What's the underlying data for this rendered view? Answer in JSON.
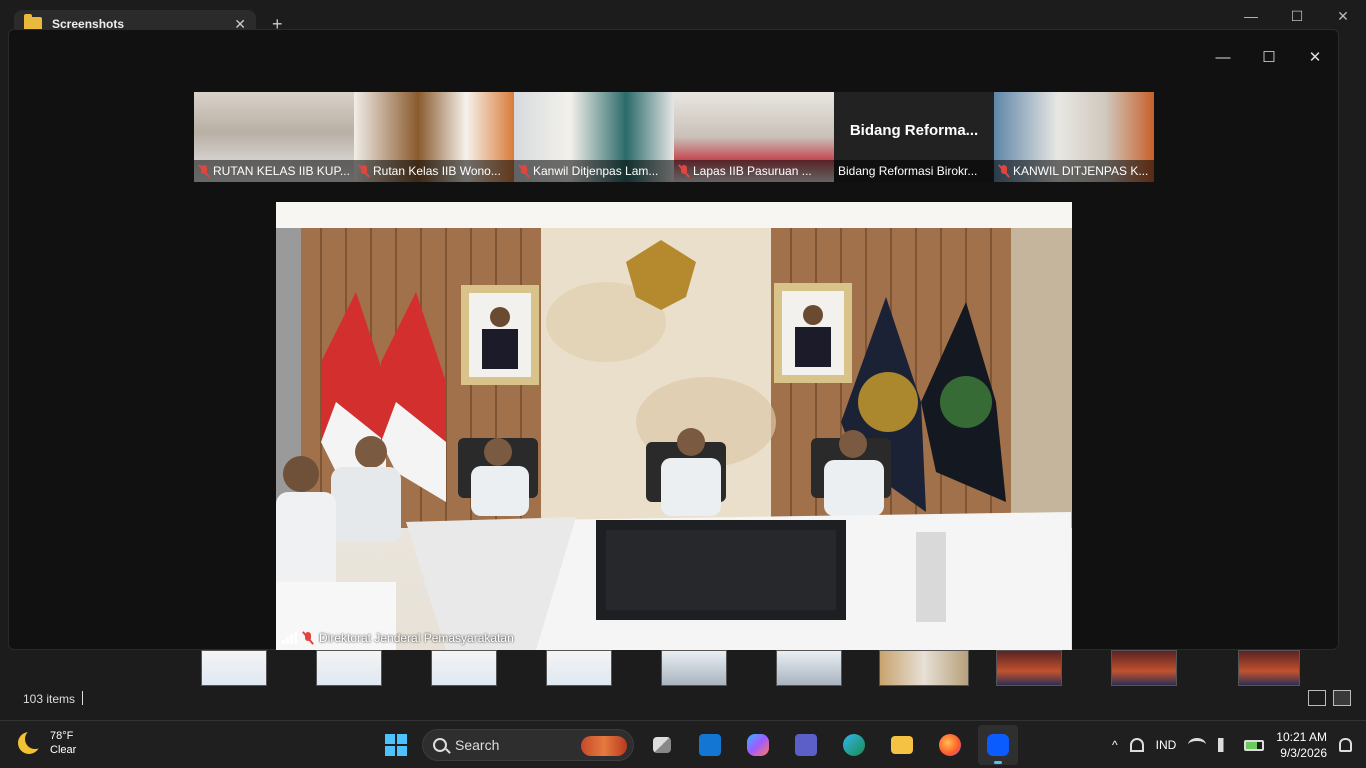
{
  "explorer": {
    "tab_title": "Screenshots",
    "tab_close": "✕",
    "new_tab": "+",
    "minimize": "—",
    "maximize": "☐",
    "close": "✕",
    "item_count": "103 items"
  },
  "zoom": {
    "minimize": "—",
    "maximize": "☐",
    "close": "✕",
    "gallery": [
      {
        "name": "RUTAN KELAS IIB KUP..."
      },
      {
        "name": "Rutan Kelas IIB Wono..."
      },
      {
        "name": "Kanwil Ditjenpas Lam..."
      },
      {
        "name": "Lapas IIB Pasuruan ..."
      },
      {
        "name": "Bidang Reformasi Birokr...",
        "big_label": "Bidang Reforma..."
      },
      {
        "name": "KANWIL DITJENPAS K..."
      }
    ],
    "active_speaker": "Direktorat Jenderal Pemasyarakatan"
  },
  "taskbar": {
    "weather_temp": "78°F",
    "weather_cond": "Clear",
    "search_label": "Search",
    "language": "IND",
    "time": "10:21 AM",
    "date": "9/3/2026",
    "chevron": "^"
  },
  "colors": {
    "accent": "#4cc2ff",
    "mute_red": "#e0463f",
    "taskbar_bg": "#1f1f1f",
    "zoom_bg": "#111111"
  }
}
